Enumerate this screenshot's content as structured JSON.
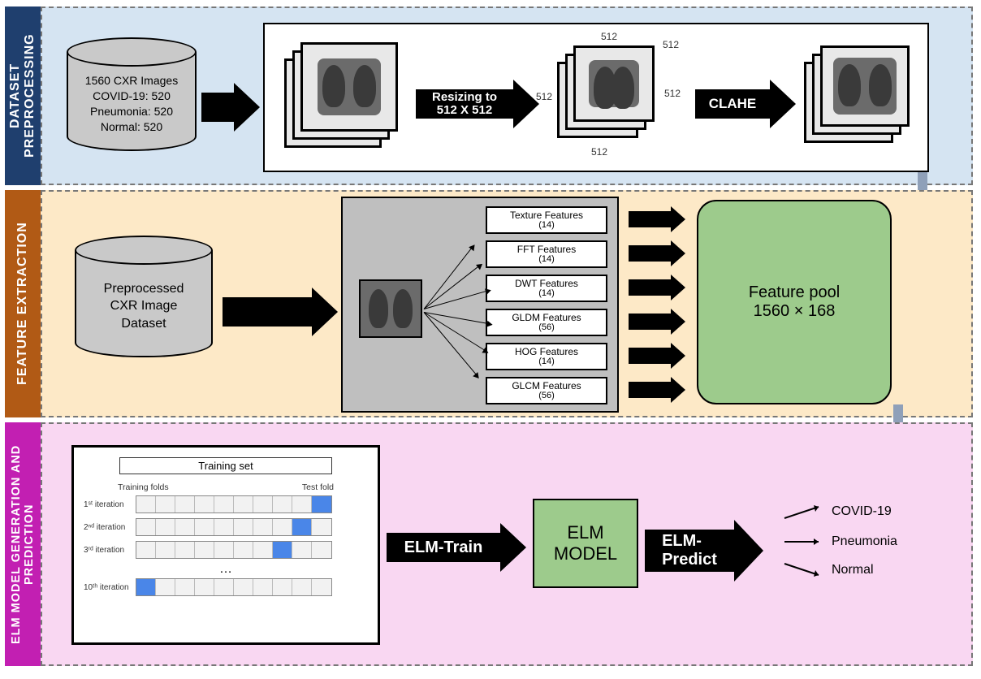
{
  "stage_labels": {
    "preprocess": "DATASET PREPROCESSING",
    "feature": "FEATURE EXTRACTION",
    "elm": "ELM MODEL GENERATION AND PREDICTION"
  },
  "dataset_cylinder": {
    "line1": "1560 CXR Images",
    "line2": "COVID-19: 520",
    "line3": "Pneumonia: 520",
    "line4": "Normal: 520"
  },
  "preprocess_arrows": {
    "resize": "Resizing  to\n512 X 512",
    "clahe": "CLAHE"
  },
  "resize_dim_label": "512",
  "preprocessed_cyl": {
    "line1": "Preprocessed",
    "line2": "CXR Image",
    "line3": "Dataset"
  },
  "features": [
    {
      "name": "Texture Features",
      "count": "(14)"
    },
    {
      "name": "FFT Features",
      "count": "(14)"
    },
    {
      "name": "DWT Features",
      "count": "(14)"
    },
    {
      "name": "GLDM Features",
      "count": "(56)"
    },
    {
      "name": "HOG Features",
      "count": "(14)"
    },
    {
      "name": "GLCM Features",
      "count": "(56)"
    }
  ],
  "feature_pool": {
    "title": "Feature pool",
    "dims": "1560 × 168"
  },
  "kfold": {
    "training_set": "Training set",
    "training_folds": "Training folds",
    "test_fold": "Test fold",
    "rows": [
      {
        "label": "1ˢᵗ iteration",
        "test_index": 9
      },
      {
        "label": "2ⁿᵈ iteration",
        "test_index": 8
      },
      {
        "label": "3ʳᵈ iteration",
        "test_index": 7
      },
      {
        "label": "10ᵗʰ iteration",
        "test_index": 0
      }
    ],
    "ellipsis": "…"
  },
  "elm_arrows": {
    "train": "ELM-Train",
    "predict": "ELM-\nPredict"
  },
  "elm_model_label": "ELM\nMODEL",
  "outputs": [
    "COVID-19",
    "Pneumonia",
    "Normal"
  ]
}
